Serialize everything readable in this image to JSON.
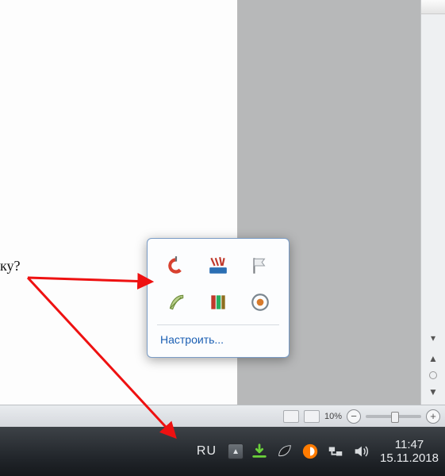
{
  "document": {
    "fragment_text": "ку?"
  },
  "status": {
    "zoom_text": "10%"
  },
  "scroll": {
    "double_up": "▲",
    "dot": "",
    "double_down": "▼",
    "collapse": "▾"
  },
  "popup": {
    "configure_label": "Настроить...",
    "icons": [
      {
        "name": "ccleaner-icon"
      },
      {
        "name": "brush-tool-icon"
      },
      {
        "name": "flag-icon"
      },
      {
        "name": "feather-icon"
      },
      {
        "name": "books-icon"
      },
      {
        "name": "target-icon"
      }
    ]
  },
  "taskbar": {
    "language": "RU",
    "hidden_arrow": "▲",
    "time": "11:47",
    "date": "15.11.2018"
  }
}
